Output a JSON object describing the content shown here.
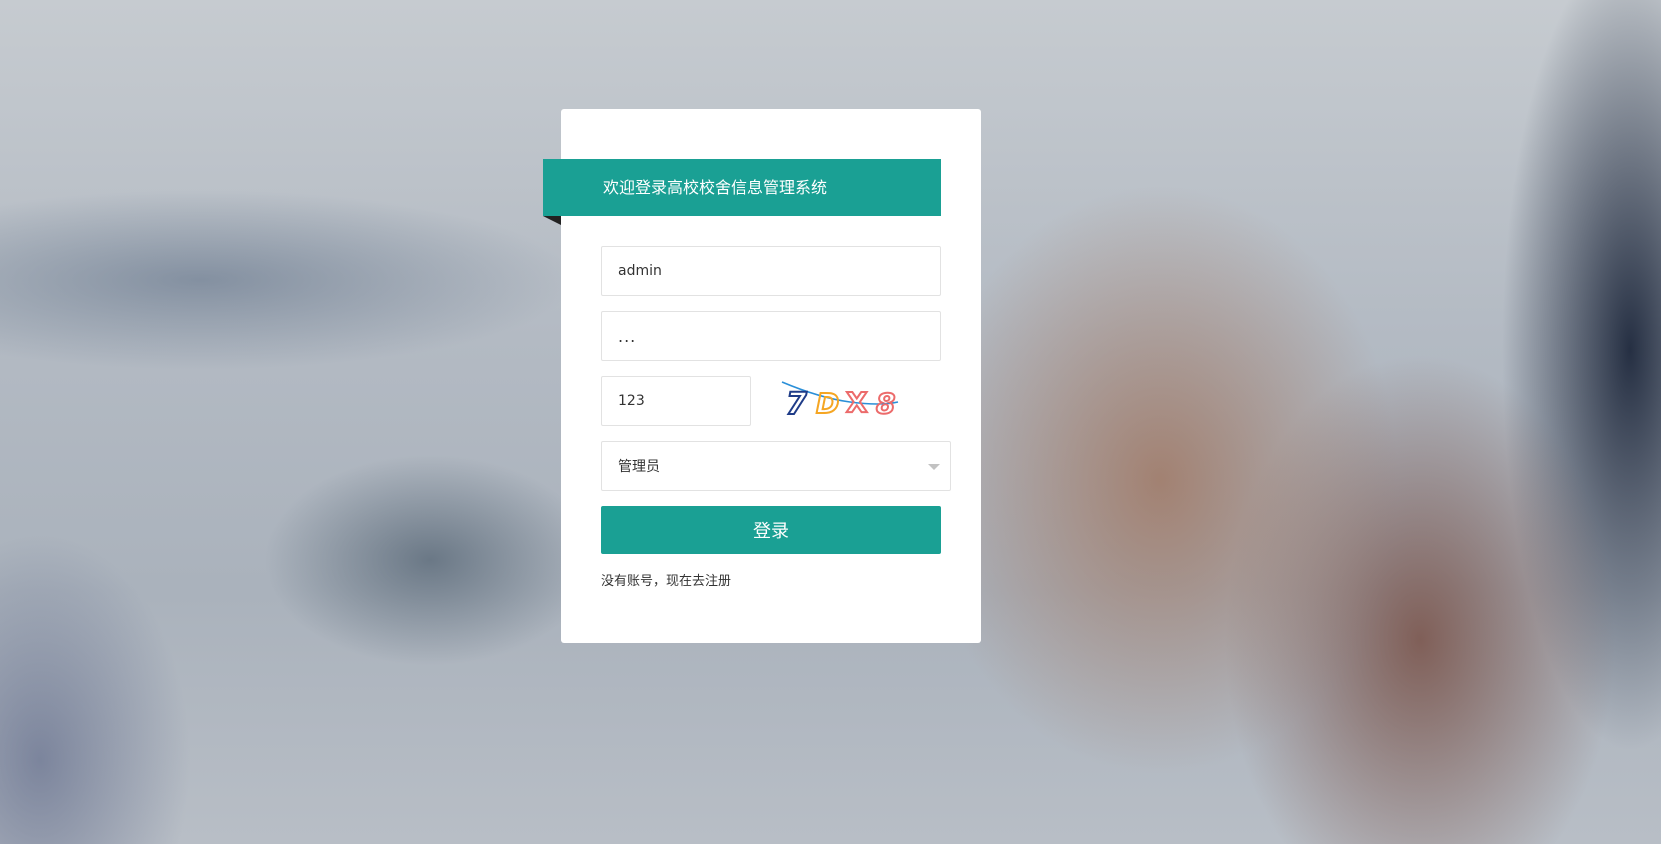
{
  "login": {
    "title": "欢迎登录高校校舍信息管理系统",
    "username_value": "admin",
    "password_value": "...",
    "captcha_value": "123",
    "captcha_image_text": "7DX8",
    "role_selected": "管理员",
    "login_label": "登录",
    "register_text": "没有账号，现在去注册"
  },
  "colors": {
    "accent": "#1aa094",
    "captcha_glyphs": [
      "#1f3c88",
      "#f5a623",
      "#ec6b6b",
      "#ec6b6b"
    ],
    "captcha_line": "#2a8fd8"
  }
}
